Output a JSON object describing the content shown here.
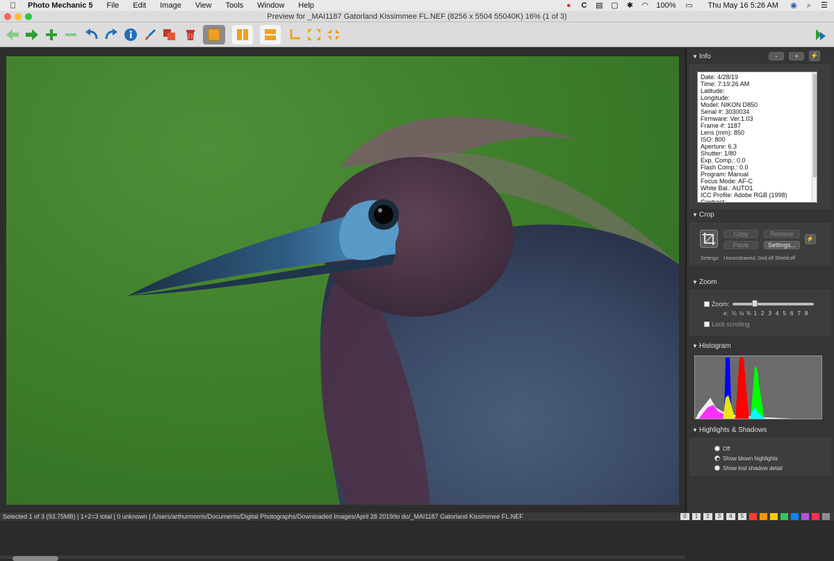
{
  "menubar": {
    "app_name": "Photo Mechanic 5",
    "items": [
      "File",
      "Edit",
      "Image",
      "View",
      "Tools",
      "Window",
      "Help"
    ],
    "battery": "100%",
    "clock": "Thu May 16  5:26 AM"
  },
  "window": {
    "title": "Preview for _MAI1187  Gatorland Kissimmee FL.NEF (8256 x 5504 55040K) 16% (1 of 3)"
  },
  "toolbar": {
    "icons": [
      "back-arrow-icon",
      "forward-arrow-icon",
      "add-icon",
      "remove-icon",
      "rotate-left-icon",
      "rotate-right-icon",
      "info-icon",
      "brush-icon",
      "duplicate-icon",
      "trash-icon",
      "single-view-icon",
      "side-by-side-icon",
      "stacked-view-icon",
      "crop-corner-icon",
      "expand-icon",
      "collapse-icon"
    ],
    "colors": {
      "green": "#3fa33a",
      "blue": "#1f6fb8",
      "red": "#c0392b",
      "orange": "#f0a020"
    }
  },
  "panel": {
    "info": {
      "title": "Info",
      "buttons": [
        "-",
        "+",
        "⚡"
      ],
      "lines": [
        "Date: 4/28/19",
        "Time: 7:19:26 AM",
        "Latitude:",
        "Longitude:",
        "Model: NIKON D850",
        "Serial #: 3030034",
        "Firmware: Ver.1.03",
        "Frame #: 1187",
        "Lens (mm): 850",
        "ISO: 800",
        "Aperture: 6.3",
        "Shutter: 1/80",
        "Exp. Comp.: 0.0",
        "Flash Comp.: 0.0",
        "Program: Manual",
        "Focus Mode: AF-C",
        "White Bal.: AUTO1",
        "ICC Profile: Adobe RGB (1998)",
        "Contrast:"
      ]
    },
    "crop": {
      "title": "Crop",
      "copy": "Copy",
      "remove": "Remove",
      "paste": "Paste",
      "settings": "Settings...",
      "settings_label": "Settings:",
      "settings_value": "Unconstrained, Grid:off Shield:off"
    },
    "zoom": {
      "title": "Zoom",
      "zoom_label": "Zoom:",
      "x_label": "x:",
      "levels": [
        "¼",
        "½",
        "¾",
        "1",
        "2",
        "3",
        "4",
        "5",
        "6",
        "7",
        "8"
      ],
      "lock_label": "Lock scrolling",
      "slider_level": 0.27
    },
    "histogram": {
      "title": "Histogram"
    },
    "highlights": {
      "title": "Highlights & Shadows",
      "options": [
        "Off",
        "Show blown highlights",
        "Show lost shadow detail"
      ],
      "selected": 1
    }
  },
  "statusbar": {
    "text": "Selected  1 of 3 (93.75MB)  |  1+2=3 total  |  0 unknown  |  /Users/arthurmorris/Documents/Digital Photographs/Downloaded Images/April 28 2019/to do/_MAI1187  Gatorland Kissimmee FL.NEF",
    "rating_chips": [
      "0",
      "1",
      "2",
      "3",
      "4",
      "5"
    ],
    "color_chips": [
      "#ff3b30",
      "#ff9500",
      "#ffcc00",
      "#34c759",
      "#0a84ff",
      "#af52de",
      "#ff2d55",
      "#8e8e93"
    ]
  }
}
